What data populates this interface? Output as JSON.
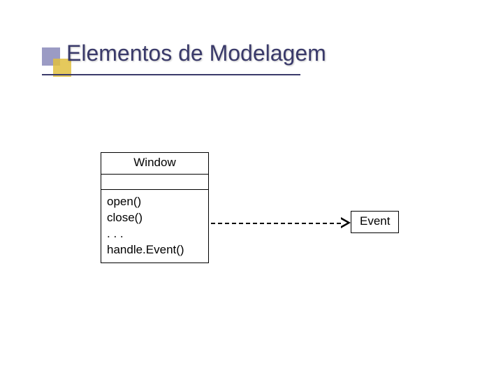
{
  "title": "Elementos de Modelagem",
  "uml_class": {
    "name": "Window",
    "operations": [
      "open()",
      "close()",
      ". . .",
      "handle.Event()"
    ]
  },
  "event_box": {
    "label": "Event"
  }
}
